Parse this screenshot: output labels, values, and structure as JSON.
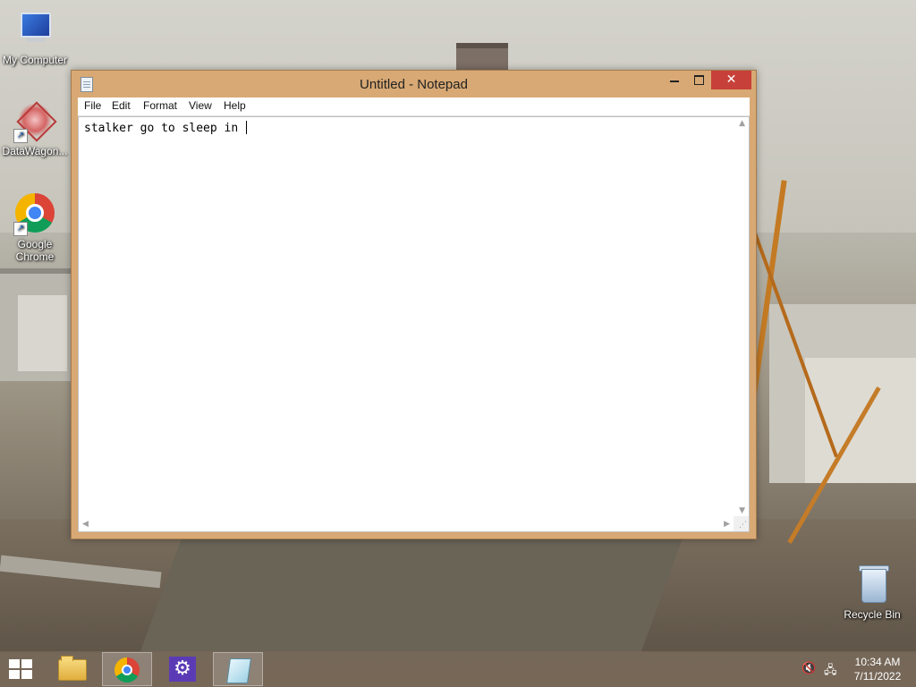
{
  "desktop": {
    "icons": [
      {
        "label": "My Computer"
      },
      {
        "label": "DataWagon..."
      },
      {
        "label": "Google Chrome"
      },
      {
        "label": "Recycle Bin"
      }
    ]
  },
  "window": {
    "title": "Untitled - Notepad",
    "controls": {
      "minimize": "minimize",
      "maximize": "maximize",
      "close": "✕"
    },
    "menu": [
      "File",
      "Edit",
      "Format",
      "View",
      "Help"
    ],
    "content": "stalker go to sleep in "
  },
  "taskbar": {
    "apps": [
      {
        "name": "file-explorer",
        "icon": "folder-icon"
      },
      {
        "name": "google-chrome",
        "icon": "chrome-icon"
      },
      {
        "name": "control-panel",
        "icon": "gear-icon"
      },
      {
        "name": "notepad",
        "icon": "notepad-icon",
        "active": true
      }
    ],
    "tray": {
      "volume_icon": "speaker-muted-icon",
      "network_icon": "network-icon",
      "time": "10:34 AM",
      "date": "7/11/2022"
    }
  },
  "colors": {
    "window_frame": "#d8a974",
    "close_button": "#c7413a",
    "taskbar": "#786858"
  }
}
